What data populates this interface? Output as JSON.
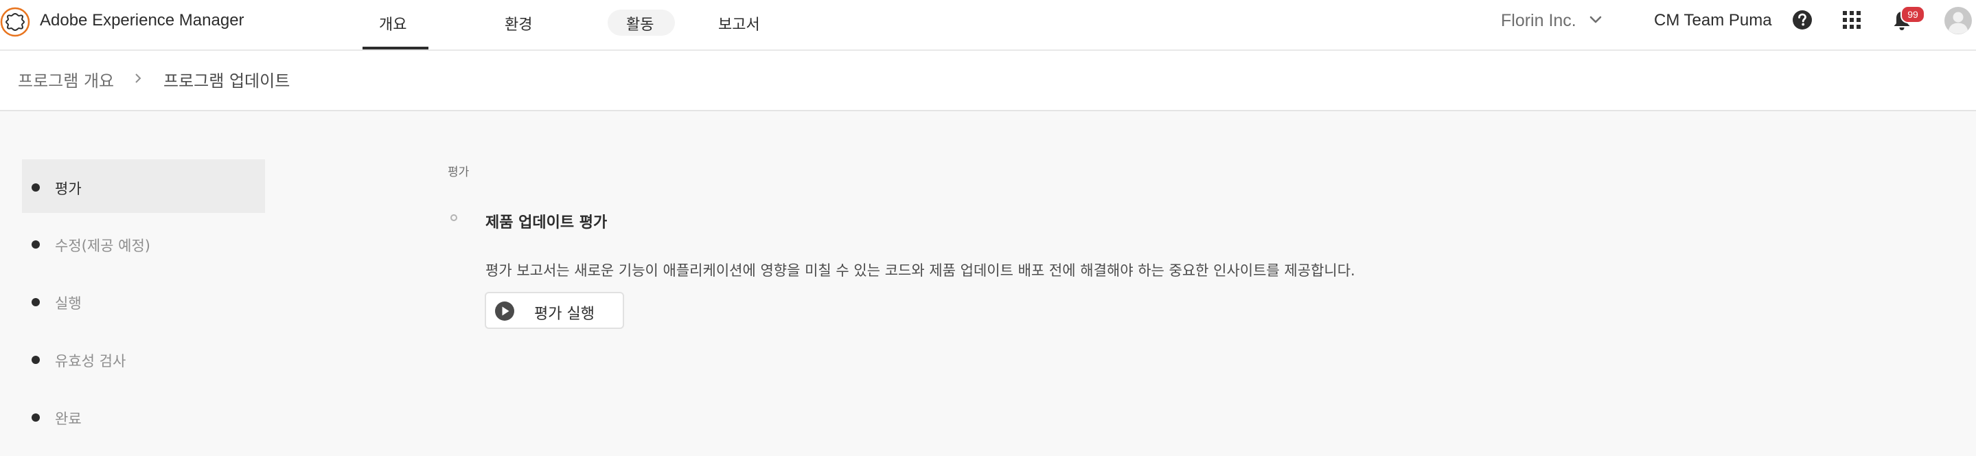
{
  "app": {
    "title": "Adobe Experience Manager"
  },
  "nav": {
    "tabs": [
      {
        "label": "개요",
        "active": true
      },
      {
        "label": "환경",
        "active": false
      },
      {
        "label": "활동",
        "active": false
      },
      {
        "label": "보고서",
        "active": false
      }
    ]
  },
  "header": {
    "org": "Florin Inc.",
    "team": "CM Team Puma",
    "notification_count": "99",
    "icons": [
      "help-icon",
      "app-switcher-icon",
      "bell-icon",
      "avatar"
    ]
  },
  "breadcrumb": {
    "parent": "프로그램 개요",
    "current": "프로그램 업데이트"
  },
  "steps": [
    {
      "label": "평가",
      "active": true
    },
    {
      "label": "수정(제공 예정)",
      "active": false
    },
    {
      "label": "실행",
      "active": false
    },
    {
      "label": "유효성 검사",
      "active": false
    },
    {
      "label": "완료",
      "active": false
    }
  ],
  "main": {
    "section_label": "평가",
    "card": {
      "title": "제품 업데이트 평가",
      "description": "평가 보고서는 새로운 기능이 애플리케이션에 영향을 미칠 수 있는 코드와 제품 업데이트 배포 전에 해결해야 하는 중요한 인사이트를 제공합니다.",
      "run_button": "평가 실행"
    }
  },
  "colors": {
    "brand": "#eb1000",
    "badge": "#d7373f",
    "text": "#2c2c2c",
    "muted": "#8e8e8e"
  }
}
